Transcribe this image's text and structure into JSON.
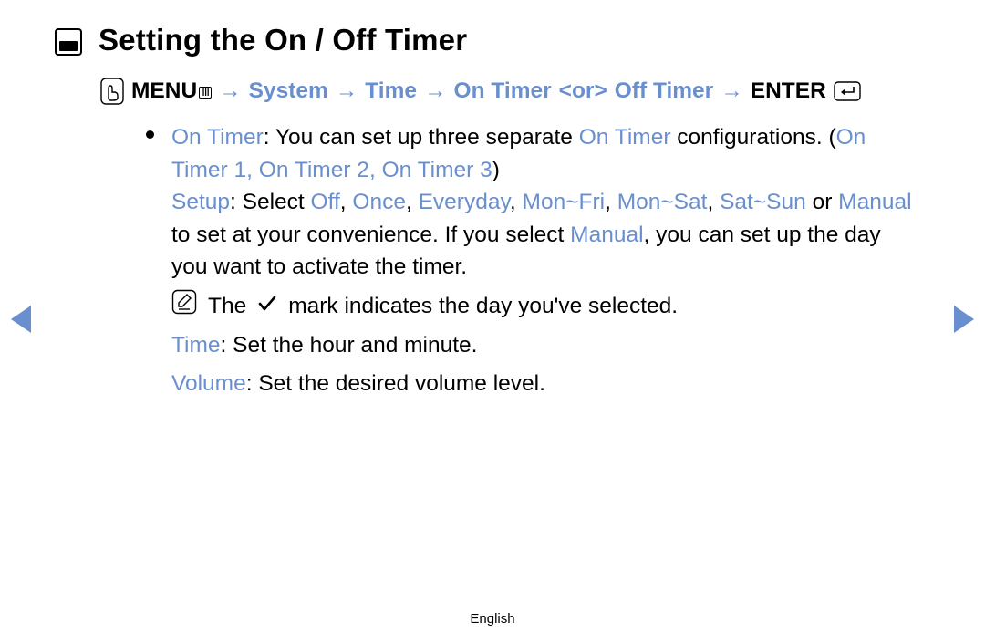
{
  "title": "Setting the On / Off Timer",
  "path": {
    "menu_label": "MENU",
    "arrow": "→",
    "seg_system": "System",
    "seg_time": "Time",
    "seg_on_timer": "On Timer",
    "or_open": "<or>",
    "seg_off_timer": "Off Timer",
    "enter_label": "ENTER"
  },
  "body": {
    "on_timer_label": "On Timer",
    "on_timer_tail1": ": You can set up three separate ",
    "on_timer_word": "On Timer",
    "on_timer_tail2": " configurations. (",
    "ot1": "On Timer 1",
    "comma1": ", ",
    "ot2": "On Timer 2",
    "comma2": ", ",
    "ot3": "On Timer 3",
    "close_paren": ")",
    "setup_label": "Setup",
    "setup_tail1": ": Select ",
    "opt_off": "Off",
    "csep": ", ",
    "opt_once": "Once",
    "opt_everyday": "Everyday",
    "opt_monfri": "Mon~Fri",
    "opt_monsat": "Mon~Sat",
    "opt_satsun": "Sat~Sun",
    "or_word": " or ",
    "opt_manual": "Manual",
    "setup_tail2": " to set at your convenience. If you select ",
    "opt_manual2": "Manual",
    "setup_tail3": ", you can set up the day you want to activate the timer.",
    "note_pre": "The ",
    "note_post": " mark indicates the day you've selected.",
    "time_label": "Time",
    "time_tail": ": Set the hour and minute.",
    "volume_label": "Volume",
    "volume_tail": ": Set the desired volume level."
  },
  "footer": "English"
}
